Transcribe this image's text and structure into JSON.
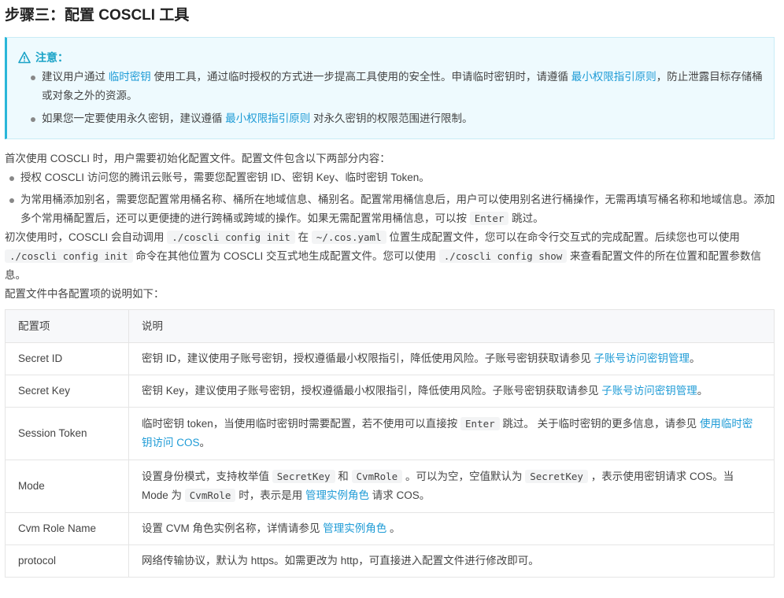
{
  "heading": "步骤三：配置 COSCLI 工具",
  "notice": {
    "title": "注意：",
    "items": [
      {
        "pre": "建议用户通过 ",
        "link1": "临时密钥",
        "mid": " 使用工具，通过临时授权的方式进一步提高工具使用的安全性。申请临时密钥时，请遵循 ",
        "link2": "最小权限指引原则",
        "post": "，防止泄露目标存储桶或对象之外的资源。"
      },
      {
        "pre": "如果您一定要使用永久密钥，建议遵循 ",
        "link1": "最小权限指引原则",
        "post": " 对永久密钥的权限范围进行限制。"
      }
    ]
  },
  "intro": "首次使用 COSCLI 时，用户需要初始化配置文件。配置文件包含以下两部分内容：",
  "bullets": [
    {
      "text": "授权 COSCLI 访问您的腾讯云账号，需要您配置密钥 ID、密钥 Key、临时密钥 Token。"
    },
    {
      "pre": "为常用桶添加别名，需要您配置常用桶名称、桶所在地域信息、桶别名。配置常用桶信息后，用户可以使用别名进行桶操作，无需再填写桶名称和地域信息。添加多个常用桶配置后，还可以更便捷的进行跨桶或跨域的操作。如果无需配置常用桶信息，可以按 ",
      "code": "Enter",
      "post": " 跳过。"
    }
  ],
  "para2": {
    "pre": "初次使用时，COSCLI 会自动调用 ",
    "code1": "./coscli config init",
    "mid1": " 在 ",
    "code2": "~/.cos.yaml",
    "mid2": " 位置生成配置文件，您可以在命令行交互式的完成配置。后续您也可以使用 ",
    "code3": "./coscli config init",
    "mid3": " 命令在其他位置为 COSCLI 交互式地生成配置文件。您可以使用 ",
    "code4": "./coscli config show",
    "post": " 来查看配置文件的所在位置和配置参数信息。"
  },
  "para3": "配置文件中各配置项的说明如下：",
  "table": {
    "headers": [
      "配置项",
      "说明"
    ],
    "rows": [
      {
        "key": "Secret ID",
        "pre": "密钥 ID，建议使用子账号密钥，授权遵循最小权限指引，降低使用风险。子账号密钥获取请参见 ",
        "link": "子账号访问密钥管理",
        "post": "。"
      },
      {
        "key": "Secret Key",
        "pre": "密钥 Key，建议使用子账号密钥，授权遵循最小权限指引，降低使用风险。子账号密钥获取请参见 ",
        "link": "子账号访问密钥管理",
        "post": "。"
      },
      {
        "key": "Session Token",
        "pre": "临时密钥 token，当使用临时密钥时需要配置，若不使用可以直接按 ",
        "code": "Enter",
        "mid": " 跳过。 关于临时密钥的更多信息，请参见 ",
        "link": "使用临时密钥访问 COS",
        "post": "。"
      },
      {
        "key": "Mode",
        "pre": "设置身份模式，支持枚举值 ",
        "code1": "SecretKey",
        "mid1": " 和 ",
        "code2": "CvmRole",
        "mid2": " 。可以为空，空值默认为 ",
        "code3": "SecretKey",
        "mid3": " ，表示使用密钥请求 COS。当 Mode 为 ",
        "code4": "CvmRole",
        "mid4": " 时，表示是用 ",
        "link": "管理实例角色",
        "post": " 请求 COS。"
      },
      {
        "key": "Cvm Role Name",
        "pre": "设置 CVM 角色实例名称，详情请参见 ",
        "link": "管理实例角色",
        "post": " 。"
      },
      {
        "key": "protocol",
        "text": "网络传输协议，默认为 https。如需更改为 http，可直接进入配置文件进行修改即可。"
      }
    ]
  },
  "colors": {
    "link": "#1e9bd6",
    "notice_bg": "#eefafe",
    "notice_border": "#29b6d9",
    "notice_title": "#1aa3c7"
  }
}
